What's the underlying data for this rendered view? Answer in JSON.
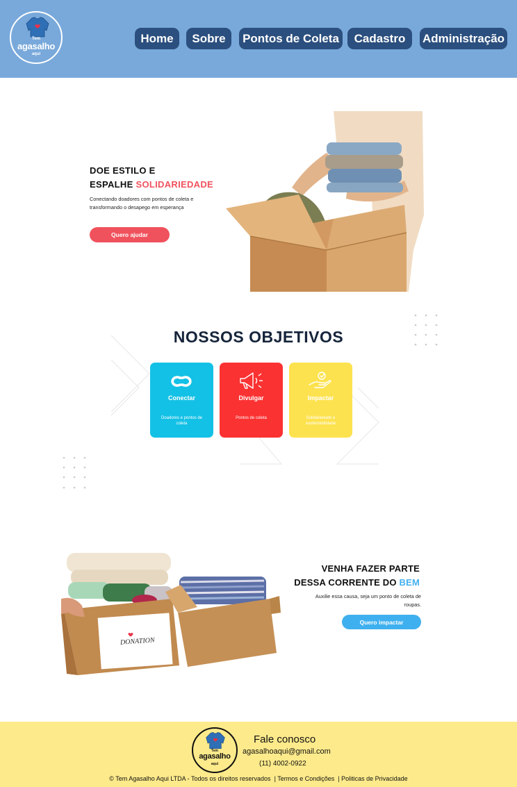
{
  "header": {
    "logo": {
      "top": "Tem",
      "main": "agasalho",
      "bottom": "aqui"
    },
    "nav": [
      "Home",
      "Sobre",
      "Pontos de Coleta",
      "Cadastro",
      "Administração"
    ]
  },
  "hero": {
    "title_line1": "DOE ESTILO E",
    "title_line2": "ESPALHE",
    "title_accent": "SOLIDARIEDADE",
    "text": "Conectando doadores com pontos de coleta e transformando o desapego em esperança",
    "button": "Quero ajudar"
  },
  "objectives": {
    "title": "NOSSOS OBJETIVOS",
    "cards": [
      {
        "title": "Conectar",
        "desc": "Doadores e pontos de coleta",
        "color": "#14c1e6",
        "icon": "link-icon"
      },
      {
        "title": "Divulgar",
        "desc": "Pontos de coleta",
        "color": "#fb3232",
        "icon": "megaphone-icon"
      },
      {
        "title": "Impactar",
        "desc": "Solidariedade e sustentabilidade",
        "color": "#fde24f",
        "icon": "giving-hand-icon"
      }
    ]
  },
  "join": {
    "title_line1": "VENHA FAZER PARTE",
    "title_line2": "DESSA CORRENTE DO",
    "title_accent": "BEM",
    "text": "Auxilie essa causa, seja um ponto de coleta de roupas.",
    "button": "Quero impactar",
    "box_label": "DONATION"
  },
  "footer": {
    "logo": {
      "top": "Tem",
      "main": "agasalho",
      "bottom": "aqui"
    },
    "title": "Fale conosco",
    "email": "agasalhoaqui@gmail.com",
    "phone": "(11) 4002-0922",
    "copyright": "© Tem Agasalho Aqui LTDA - Todos os direitos reservados",
    "terms": "Termos e Condições",
    "privacy": "Politicas de Privacidade"
  },
  "colors": {
    "header_bg": "#79a9db",
    "nav_btn": "#2b4f7e",
    "accent_red": "#f0525d",
    "accent_blue": "#3fb0ef",
    "footer_bg": "#fdea8b"
  }
}
